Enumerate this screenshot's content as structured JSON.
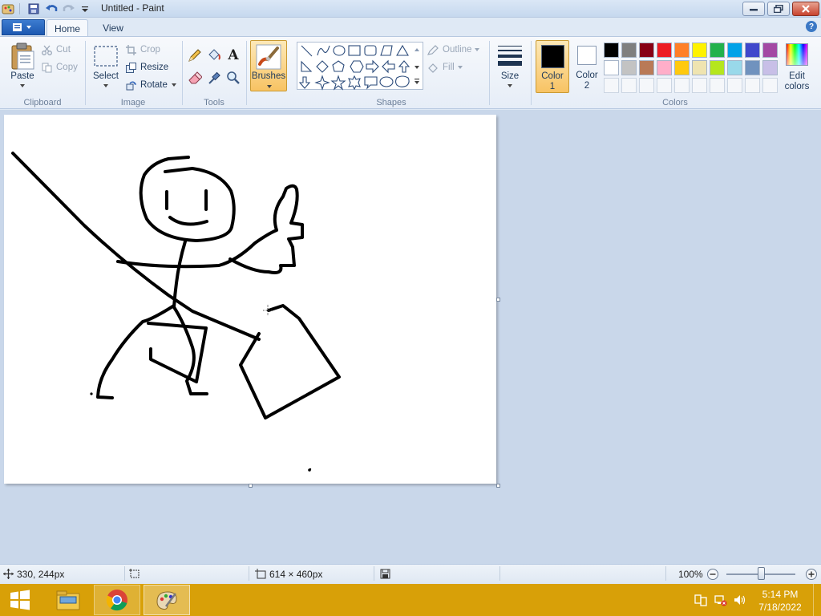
{
  "window": {
    "title": "Untitled - Paint"
  },
  "tabs": {
    "file_label": "",
    "home": "Home",
    "view": "View"
  },
  "clipboard": {
    "paste": "Paste",
    "cut": "Cut",
    "copy": "Copy",
    "group": "Clipboard"
  },
  "image": {
    "select": "Select",
    "crop": "Crop",
    "resize": "Resize",
    "rotate": "Rotate",
    "group": "Image"
  },
  "tools": {
    "group": "Tools",
    "text_tool": "A"
  },
  "brushes": {
    "label": "Brushes"
  },
  "shapes": {
    "group": "Shapes",
    "outline": "Outline",
    "fill": "Fill"
  },
  "size": {
    "label": "Size"
  },
  "colors": {
    "color1_label_line1": "Color",
    "color1_label_line2": "1",
    "color2_label_line1": "Color",
    "color2_label_line2": "2",
    "edit_line1": "Edit",
    "edit_line2": "colors",
    "group": "Colors",
    "color1": "#000000",
    "color2": "#ffffff",
    "palette_row1": [
      "#000000",
      "#7f7f7f",
      "#880015",
      "#ed1c24",
      "#ff7f27",
      "#fff200",
      "#22b14c",
      "#00a2e8",
      "#3f48cc",
      "#a349a4"
    ],
    "palette_row2": [
      "#ffffff",
      "#c3c3c3",
      "#b97a57",
      "#ffaec9",
      "#ffc90e",
      "#efe4b0",
      "#b5e61d",
      "#99d9ea",
      "#7092be",
      "#c8bfe7"
    ]
  },
  "status": {
    "cursor_pos": "330, 244px",
    "canvas_size": "614 × 460px",
    "zoom": "100%"
  },
  "taskbar": {
    "time": "5:14 PM",
    "date": "7/18/2022"
  },
  "accent": "#f8c363",
  "taskbar_color": "#d8a008"
}
